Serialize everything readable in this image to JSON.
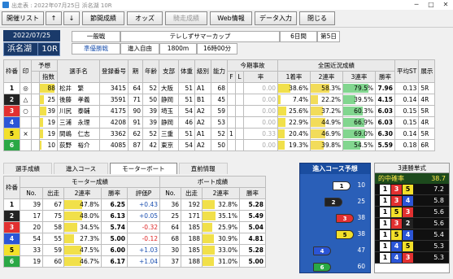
{
  "window": {
    "title": "出走表 : 2022年07月25日 浜名湖 10R"
  },
  "toolbar": {
    "buttons": [
      {
        "label": "開催リスト",
        "dis": false
      },
      {
        "label": "↑",
        "dis": false
      },
      {
        "label": "↓",
        "dis": false
      },
      {
        "label": "節間成績",
        "dis": false
      },
      {
        "label": "オッズ",
        "dis": false
      },
      {
        "label": "騎走成績",
        "dis": true
      },
      {
        "label": "Web情報",
        "dis": false
      },
      {
        "label": "データ入力",
        "dis": false
      },
      {
        "label": "閉じる",
        "dis": false
      }
    ]
  },
  "race": {
    "date": "2022/07/25",
    "venue": "浜名湖",
    "race_no": "10R",
    "grade": "一般戦",
    "title": "テレしずサマーカップ",
    "days": "6日間",
    "day_no": "第5日",
    "class": "準優勝戦",
    "entry": "進入自由",
    "distance": "1800m",
    "post_time": "16時00分"
  },
  "main_headers": {
    "frame": "枠番",
    "mark": "印",
    "pred": "予想",
    "index": "指数",
    "name": "選手名",
    "reg": "登録番号",
    "age": "期",
    "year": "年齢",
    "branch": "支部",
    "weight": "体重",
    "rank": "級別",
    "ability": "能力",
    "accident": "今期事故",
    "f": "F",
    "l": "L",
    "rate": "率",
    "recent": "全国近況成績",
    "r1": "1着率",
    "r2": "2連率",
    "r3": "3連率",
    "win": "勝率",
    "st": "平均ST",
    "exh": "展示"
  },
  "entries": [
    {
      "lane": "1",
      "mark": "◎",
      "pred": "88",
      "name": "松井　繁",
      "reg": "3415",
      "age": "64",
      "year": "52",
      "branch": "大阪",
      "weight": "51",
      "rank": "A1",
      "ability": "68",
      "f": "",
      "l": "",
      "rate": "0.00",
      "r1": "38.6%",
      "r1v": 38.6,
      "r2": "58.3%",
      "r2v": 58.3,
      "r3": "79.5%",
      "r3v": 79.5,
      "win": "7.96",
      "st": "0.13",
      "exh": "5R"
    },
    {
      "lane": "2",
      "mark": "△",
      "pred": "25",
      "name": "後藤　孝義",
      "reg": "3591",
      "age": "71",
      "year": "50",
      "branch": "静岡",
      "weight": "51",
      "rank": "B1",
      "ability": "45",
      "f": "",
      "l": "",
      "rate": "0.00",
      "r1": "7.4%",
      "r1v": 7.4,
      "r2": "22.2%",
      "r2v": 22.2,
      "r3": "39.5%",
      "r3v": 39.5,
      "win": "4.15",
      "st": "0.14",
      "exh": "4R"
    },
    {
      "lane": "3",
      "mark": "○",
      "pred": "39",
      "name": "川尻　泰輔",
      "reg": "4175",
      "age": "90",
      "year": "39",
      "branch": "埼玉",
      "weight": "54",
      "rank": "A2",
      "ability": "59",
      "f": "",
      "l": "",
      "rate": "0.00",
      "r1": "25.6%",
      "r1v": 25.6,
      "r2": "37.2%",
      "r2v": 37.2,
      "r3": "60.3%",
      "r3v": 60.3,
      "win": "6.03",
      "st": "0.15",
      "exh": "5R"
    },
    {
      "lane": "4",
      "mark": "",
      "pred": "19",
      "name": "三浦　永理",
      "reg": "4208",
      "pred_dummy": "",
      "age": "91",
      "year": "39",
      "branch": "静岡",
      "weight": "46",
      "rank": "A2",
      "ability": "53",
      "f": "",
      "l": "",
      "rate": "0.00",
      "r1": "22.9%",
      "r1v": 22.9,
      "r2": "44.9%",
      "r2v": 44.9,
      "r3": "66.9%",
      "r3v": 66.9,
      "win": "6.03",
      "st": "0.15",
      "exh": "4R"
    },
    {
      "lane": "5",
      "mark": "×",
      "pred": "19",
      "name": "間嶋　仁志",
      "reg": "3362",
      "age": "62",
      "year": "52",
      "branch": "三重",
      "weight": "51",
      "rank": "A1",
      "ability": "52",
      "f": "1",
      "l": "",
      "rate": "0.33",
      "r1": "20.4%",
      "r1v": 20.4,
      "r2": "46.9%",
      "r2v": 46.9,
      "r3": "69.0%",
      "r3v": 69.0,
      "win": "6.30",
      "st": "0.14",
      "exh": "5R"
    },
    {
      "lane": "6",
      "mark": "",
      "pred": "10",
      "name": "荻野　裕介",
      "reg": "4085",
      "age": "87",
      "year": "42",
      "branch": "東京",
      "weight": "54",
      "rank": "A2",
      "ability": "50",
      "f": "",
      "l": "",
      "rate": "0.00",
      "r1": "19.3%",
      "r1v": 19.3,
      "r2": "39.8%",
      "r2v": 39.8,
      "r3": "54.5%",
      "r3v": 54.5,
      "win": "5.59",
      "st": "0.18",
      "exh": "6R"
    }
  ],
  "tabs": [
    {
      "label": "選手成績"
    },
    {
      "label": "進入コース"
    },
    {
      "label": "モーターボート",
      "active": true
    },
    {
      "label": "直前情報"
    }
  ],
  "motor_headers": {
    "frame": "枠番",
    "motor": "モーター成績",
    "no": "No.",
    "starts": "出走",
    "r2": "2連率",
    "win": "勝率",
    "eval": "評価P",
    "boat": "ボート成績"
  },
  "motor": [
    {
      "lane": "1",
      "mno": "39",
      "ms": "67",
      "mr2": "47.8%",
      "mr2v": 47.8,
      "mw": "6.25",
      "ev": "+0.43",
      "bno": "36",
      "bs": "192",
      "br2": "32.8%",
      "br2v": 32.8,
      "bw": "5.28"
    },
    {
      "lane": "2",
      "mno": "17",
      "ms": "75",
      "mr2": "48.0%",
      "mr2v": 48.0,
      "mw": "6.13",
      "ev": "+0.05",
      "bno": "25",
      "bs": "171",
      "br2": "35.1%",
      "br2v": 35.1,
      "bw": "5.49"
    },
    {
      "lane": "3",
      "mno": "20",
      "ms": "58",
      "mr2": "34.5%",
      "mr2v": 34.5,
      "mw": "5.74",
      "ev": "-0.32",
      "bno": "64",
      "bs": "185",
      "br2": "25.9%",
      "br2v": 25.9,
      "bw": "5.04"
    },
    {
      "lane": "4",
      "mno": "54",
      "ms": "55",
      "mr2": "27.3%",
      "mr2v": 27.3,
      "mw": "5.00",
      "ev": "-0.12",
      "bno": "68",
      "bs": "188",
      "br2": "30.9%",
      "br2v": 30.9,
      "bw": "4.81"
    },
    {
      "lane": "5",
      "mno": "33",
      "ms": "59",
      "mr2": "47.5%",
      "mr2v": 47.5,
      "mw": "6.00",
      "ev": "+1.03",
      "bno": "30",
      "bs": "185",
      "br2": "33.0%",
      "br2v": 33.0,
      "bw": "5.28"
    },
    {
      "lane": "6",
      "mno": "19",
      "ms": "60",
      "mr2": "46.7%",
      "mr2v": 46.7,
      "mw": "6.17",
      "ev": "+1.04",
      "bno": "37",
      "bs": "188",
      "br2": "31.0%",
      "br2v": 31.0,
      "bw": "5.00"
    }
  ],
  "pred_course": {
    "title": "進入コース予想",
    "rows": [
      {
        "lane": "1",
        "val": "10"
      },
      {
        "lane": "2",
        "val": "25"
      },
      {
        "lane": "3",
        "val": "38"
      },
      {
        "lane": "5",
        "val": "38"
      },
      {
        "lane": "4",
        "val": "47"
      },
      {
        "lane": "6",
        "val": "60"
      }
    ]
  },
  "trifecta": {
    "title": "3連勝単式",
    "rate_label": "的中確率",
    "rate": "38.7",
    "rows": [
      {
        "a": "1",
        "b": "3",
        "c": "5",
        "v": "7.2"
      },
      {
        "a": "1",
        "b": "3",
        "c": "4",
        "v": "5.8"
      },
      {
        "a": "1",
        "b": "5",
        "c": "3",
        "v": "5.6"
      },
      {
        "a": "1",
        "b": "3",
        "c": "2",
        "v": "5.6"
      },
      {
        "a": "1",
        "b": "5",
        "c": "4",
        "v": "5.4"
      },
      {
        "a": "1",
        "b": "4",
        "c": "5",
        "v": "5.3"
      },
      {
        "a": "1",
        "b": "4",
        "c": "3",
        "v": "5.3"
      }
    ]
  },
  "colors": {
    "lane1": "#ffffff",
    "lane2": "#222222",
    "lane3": "#e23030",
    "lane4": "#2b55d6",
    "lane5": "#f3e02a",
    "lane6": "#2aa845",
    "bar_yellow": "#f2dc5a",
    "bar_green": "#82d68f"
  }
}
